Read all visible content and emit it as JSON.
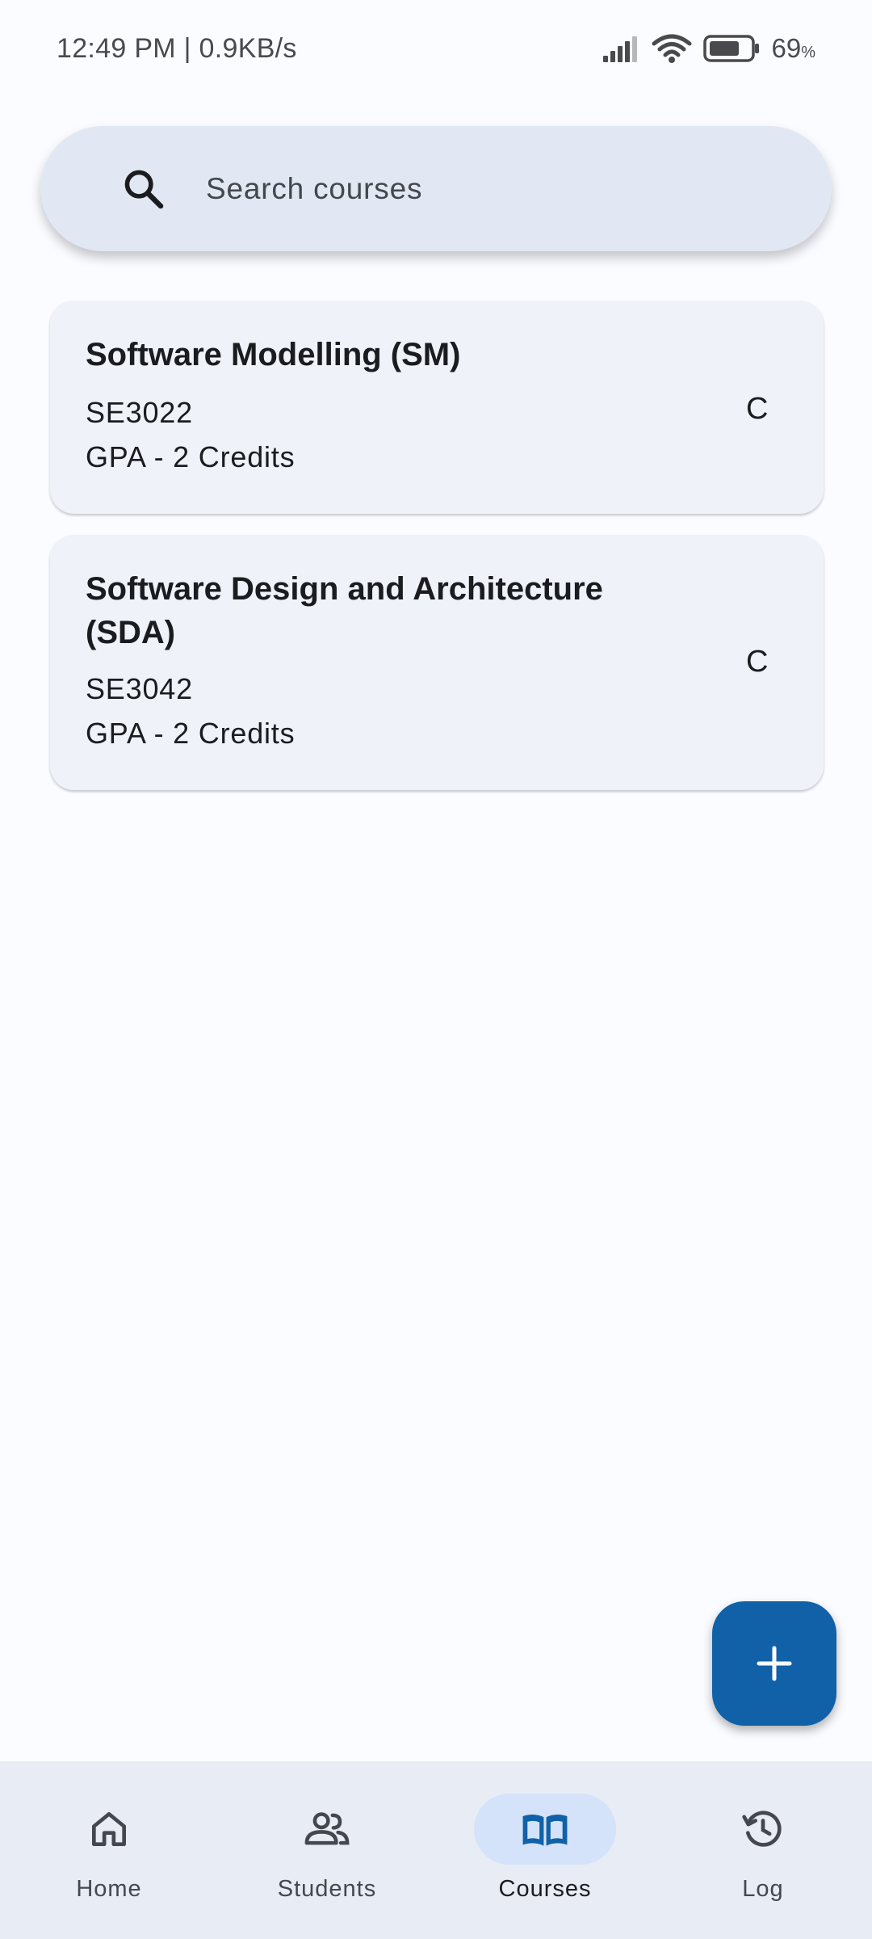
{
  "status_bar": {
    "time_speed": "12:49 PM | 0.9KB/s",
    "battery_percent": "69",
    "battery_symbol": "%"
  },
  "search": {
    "placeholder": "Search courses"
  },
  "courses": [
    {
      "title": "Software Modelling (SM)",
      "code": "SE3022",
      "credits": "GPA - 2 Credits",
      "grade": "C"
    },
    {
      "title": "Software Design and Architecture (SDA)",
      "code": "SE3042",
      "credits": "GPA - 2 Credits",
      "grade": "C"
    }
  ],
  "fab": {
    "icon": "add-icon"
  },
  "nav": {
    "items": [
      {
        "label": "Home",
        "icon": "home-icon"
      },
      {
        "label": "Students",
        "icon": "people-icon"
      },
      {
        "label": "Courses",
        "icon": "book-icon",
        "active": true
      },
      {
        "label": "Log",
        "icon": "history-icon"
      }
    ]
  },
  "colors": {
    "primary": "#1061a8",
    "card_bg": "#eff2f8",
    "search_bg": "#e1e8f3",
    "nav_bg": "#e7ecf5",
    "active_pill": "#d4e3f9"
  }
}
